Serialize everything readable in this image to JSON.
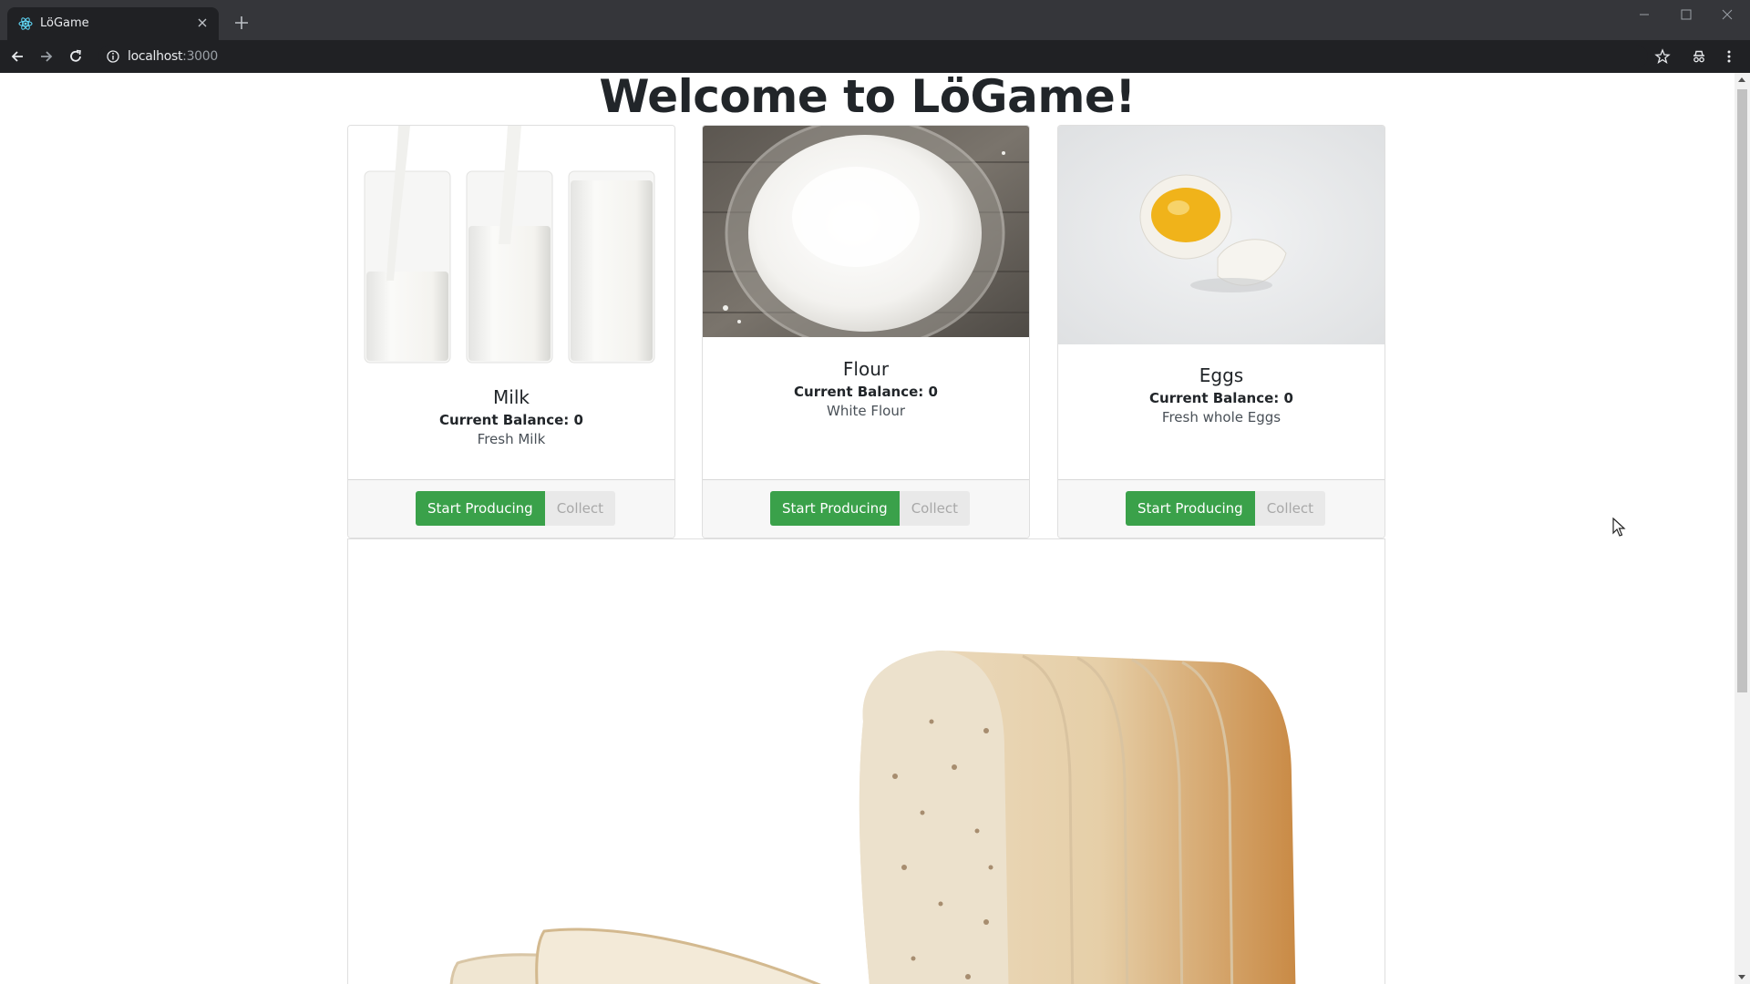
{
  "browser": {
    "tab_title": "LöGame",
    "url_host": "localhost",
    "url_port": ":3000"
  },
  "page": {
    "title": "Welcome to LöGame!"
  },
  "cards": [
    {
      "title": "Milk",
      "balance": "Current Balance: 0",
      "description": "Fresh Milk",
      "start_label": "Start Producing",
      "collect_label": "Collect"
    },
    {
      "title": "Flour",
      "balance": "Current Balance: 0",
      "description": "White Flour",
      "start_label": "Start Producing",
      "collect_label": "Collect"
    },
    {
      "title": "Eggs",
      "balance": "Current Balance: 0",
      "description": "Fresh whole Eggs",
      "start_label": "Start Producing",
      "collect_label": "Collect"
    }
  ],
  "colors": {
    "primary_button": "#3aa14a",
    "collect_button": "#e9e9e9"
  },
  "icons": [
    "react-favicon-icon",
    "close-icon",
    "plus-icon",
    "back-icon",
    "forward-icon",
    "reload-icon",
    "info-icon",
    "star-icon",
    "incognito-icon",
    "menu-icon"
  ]
}
